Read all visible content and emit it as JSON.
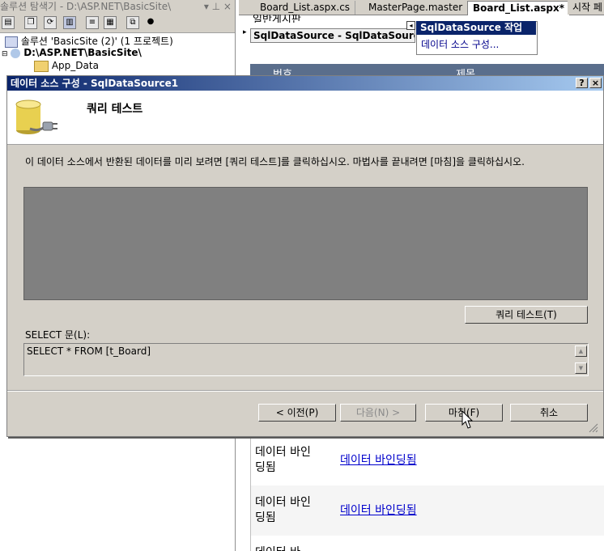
{
  "solution_explorer": {
    "title": "솔루션 탐색기 - D:\\ASP.NET\\BasicSite\\",
    "pin_glyphs": "▾ ⊥ ×",
    "tree": {
      "solution": "솔루션 'BasicSite (2)' (1 프로젝트)",
      "project": "D:\\ASP.NET\\BasicSite\\",
      "folder": "App_Data"
    }
  },
  "editor": {
    "tabs": [
      "Board_List.aspx.cs",
      "MasterPage.master",
      "Board_List.aspx*",
      "시작 페"
    ],
    "active_tab": 2,
    "top_text": "일반게시판",
    "sqldatasource_label": "SqlDataSource - SqlDataSource1",
    "smart_tag": {
      "title": "SqlDataSource 작업",
      "item": "데이터 소스 구성..."
    },
    "grid_header": [
      "번호",
      "제목"
    ],
    "rows": [
      {
        "cell": "데이터 바인딩됨",
        "link": "데이터 바인딩됨"
      },
      {
        "cell": "데이터 바인딩됨",
        "link": "데이터 바인딩됨"
      },
      {
        "cell": "데이터 바"
      }
    ]
  },
  "dialog": {
    "title": "데이터 소스 구성 - SqlDataSource1",
    "help_glyph": "?",
    "close_glyph": "×",
    "heading": "쿼리 테스트",
    "instruction": "이 데이터 소스에서 반환된 데이터를 미리 보려면 [쿼리 테스트]를 클릭하십시오. 마법사를 끝내려면 [마침]을 클릭하십시오.",
    "test_query_button": "쿼리 테스트(T)",
    "select_label": "SELECT 문(L):",
    "select_statement": "SELECT * FROM [t_Board]",
    "buttons": {
      "prev": "< 이전(P)",
      "next": "다음(N) >",
      "finish": "마침(F)",
      "cancel": "취소"
    }
  }
}
